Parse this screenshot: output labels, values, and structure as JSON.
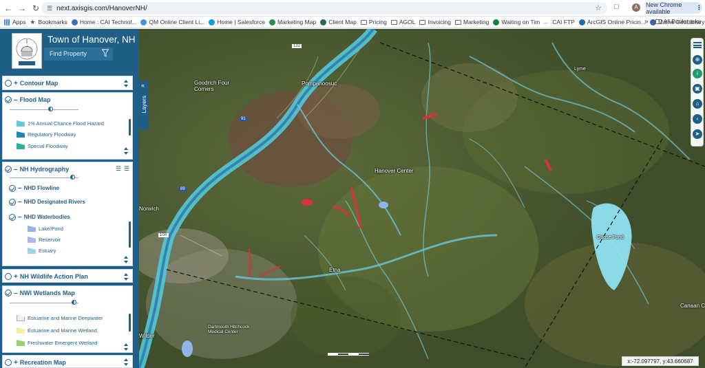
{
  "browser": {
    "url": "next.axisgis.com/HanoverNH/",
    "avatar_letter": "A",
    "new_chrome_label": "New Chrome available",
    "bookmarks": [
      {
        "label": "Apps",
        "color": "#4285f4",
        "kind": "grid"
      },
      {
        "label": "Bookmarks",
        "color": "#555555",
        "kind": "star"
      },
      {
        "label": "Home : CAI Technol...",
        "color": "#3b6fb6",
        "kind": "icon"
      },
      {
        "label": "QM Online Client Li...",
        "color": "#4a90d9",
        "kind": "icon"
      },
      {
        "label": "Home | Salesforce",
        "color": "#00a1e0",
        "kind": "icon"
      },
      {
        "label": "Marketing Map",
        "color": "#2c8a4e",
        "kind": "icon"
      },
      {
        "label": "Client Map",
        "color": "#2c6a4e",
        "kind": "icon"
      },
      {
        "label": "Pricing",
        "color": "#666666",
        "kind": "folder"
      },
      {
        "label": "AGOL",
        "color": "#666666",
        "kind": "folder"
      },
      {
        "label": "Invoicing",
        "color": "#666666",
        "kind": "folder"
      },
      {
        "label": "Marketing",
        "color": "#666666",
        "kind": "folder"
      },
      {
        "label": "Waiting on Tim",
        "color": "#188038",
        "kind": "icon"
      },
      {
        "label": "CAI FTP",
        "color": "#777777",
        "kind": "dash"
      },
      {
        "label": "ArcGIS Online Pricin...",
        "color": "#1f6fb0",
        "kind": "icon"
      },
      {
        "label": "Maine GeoLibrary",
        "color": "#3f62a8",
        "kind": "icon"
      }
    ],
    "all_bookmarks": "All Bookmarks"
  },
  "header": {
    "title": "Town of Hanover, NH",
    "find_placeholder": "Find Property",
    "logo_text": "TOWN OF HANOVER"
  },
  "layers": {
    "tab_label": "Layers",
    "sections": [
      {
        "key": "contour",
        "title": "Contour Map",
        "expanded": false
      },
      {
        "key": "flood",
        "title": "Flood Map",
        "expanded": true,
        "legend": [
          {
            "label": "1% Annual Chance Flood Hazard",
            "color": "#66c8d8"
          },
          {
            "label": "Regulatory Floodway",
            "color": "#1e88b0"
          },
          {
            "label": "Special Floodway",
            "color": "#2ab39a"
          }
        ]
      },
      {
        "key": "hydro",
        "title": "NH Hydrography",
        "expanded": true,
        "sublayers": [
          {
            "label": "NHD Flowline"
          },
          {
            "label": "NHD Designated Rivers"
          },
          {
            "label": "NHD Waterbodies"
          }
        ],
        "legend": [
          {
            "label": "Lake/Pond",
            "color": "#8fb5e8"
          },
          {
            "label": "Reservoir",
            "color": "#a9b8ef"
          },
          {
            "label": "Estuary",
            "color": "#9fd3e6"
          }
        ]
      },
      {
        "key": "wildlife",
        "title": "NH Wildlife Action Plan",
        "expanded": false
      },
      {
        "key": "wetlands",
        "title": "NWI Wetlands Map",
        "expanded": true,
        "legend": [
          {
            "label": "Estuarine and Marine Deepwater",
            "color": "#e8eef2"
          },
          {
            "label": "Estuarine and Marine Wetland",
            "color": "#f4f1a6"
          },
          {
            "label": "Freshwater Emergent Wetland",
            "color": "#9ad36a"
          }
        ]
      },
      {
        "key": "recreation",
        "title": "Recreation Map",
        "expanded": false
      }
    ]
  },
  "map": {
    "labels": {
      "goodrich": "Goodrich Four Corners",
      "pompanoosuc": "Pompanoosuc",
      "hanover_center": "Hanover Center",
      "norwich": "Norwich",
      "etna": "Etna",
      "goose_pond": "Goose Pond",
      "canaan": "Canaan C",
      "wilder": "Wilder",
      "lyme": "Lyme",
      "dartmouth": "Dartmouth Hitchcock Medical Center",
      "route_132": "132",
      "route_10a": "10A",
      "route_89": "89",
      "route_91": "91"
    },
    "coordinates": "x:-72.097797, y:43.660687"
  }
}
